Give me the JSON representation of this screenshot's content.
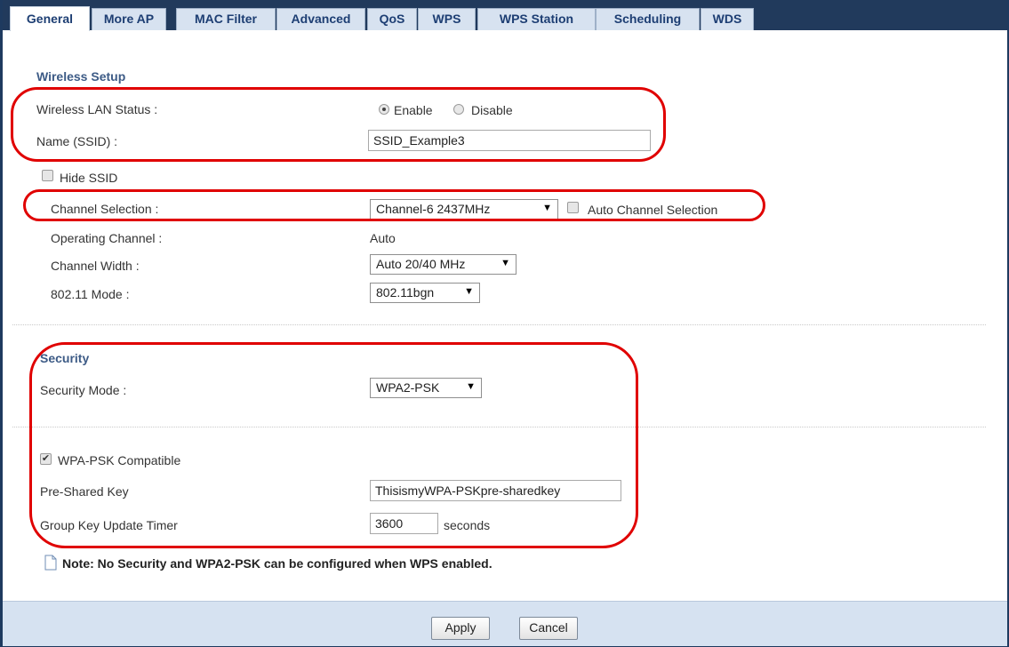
{
  "tabs": [
    {
      "label": "General",
      "active": true
    },
    {
      "label": "More AP"
    },
    {
      "label": "MAC Filter"
    },
    {
      "label": "Advanced"
    },
    {
      "label": "QoS"
    },
    {
      "label": "WPS"
    },
    {
      "label": "WPS Station"
    },
    {
      "label": "Scheduling"
    },
    {
      "label": "WDS"
    }
  ],
  "wireless": {
    "section_title": "Wireless Setup",
    "lan_status_label": "Wireless LAN Status :",
    "enable_label": "Enable",
    "disable_label": "Disable",
    "lan_status_value": "Enable",
    "ssid_label": "Name (SSID) :",
    "ssid_value": "SSID_Example3",
    "hide_ssid_label": "Hide SSID",
    "hide_ssid_checked": false,
    "channel_selection_label": "Channel Selection :",
    "channel_selection_value": "Channel-6 2437MHz",
    "auto_channel_label": "Auto Channel Selection",
    "auto_channel_checked": false,
    "operating_channel_label": "Operating Channel :",
    "operating_channel_value": "Auto",
    "channel_width_label": "Channel Width :",
    "channel_width_value": "Auto 20/40 MHz",
    "mode_label": "802.11 Mode :",
    "mode_value": "802.11bgn"
  },
  "security": {
    "section_title": "Security",
    "mode_label": "Security Mode :",
    "mode_value": "WPA2-PSK",
    "wpa_compatible_label": "WPA-PSK Compatible",
    "wpa_compatible_checked": true,
    "psk_label": "Pre-Shared Key",
    "psk_value": "ThisismyWPA-PSKpre-sharedkey",
    "group_key_label": "Group Key Update Timer",
    "group_key_value": "3600",
    "group_key_unit": "seconds"
  },
  "note": "Note: No Security and WPA2-PSK can be configured when WPS enabled.",
  "footer": {
    "apply_label": "Apply",
    "cancel_label": "Cancel"
  },
  "colors": {
    "highlight": "#e00000",
    "header": "#213a5c",
    "section_title": "#3d5b86",
    "footer": "#d6e2f1"
  }
}
